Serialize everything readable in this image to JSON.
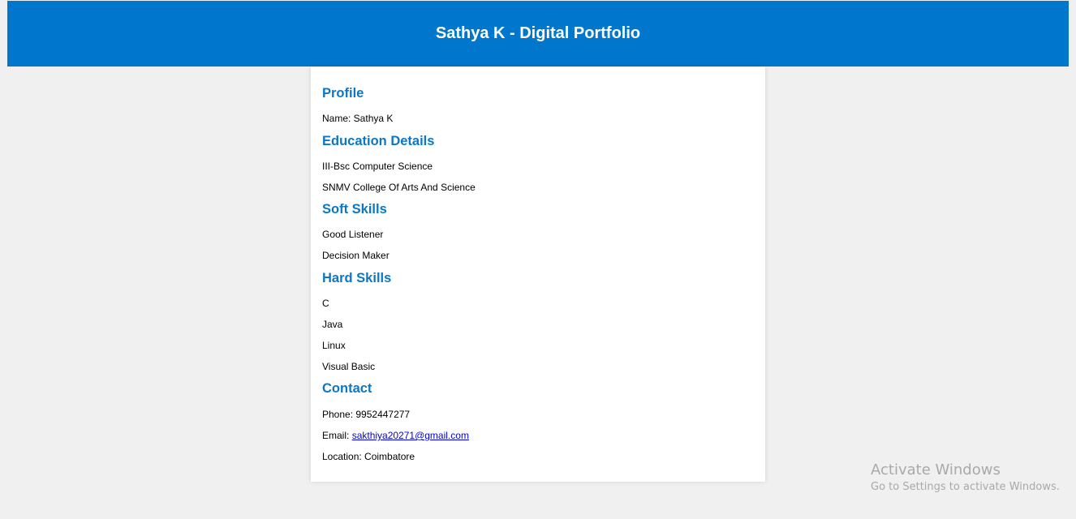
{
  "header": {
    "title": "Sathya K - Digital Portfolio",
    "background": "#0077cc"
  },
  "profile": {
    "heading": "Profile",
    "name_line": "Name: Sathya K"
  },
  "education": {
    "heading": "Education Details",
    "items": [
      "III-Bsc Computer Science",
      "SNMV College Of Arts And Science"
    ]
  },
  "soft_skills": {
    "heading": "Soft Skills",
    "items": [
      "Good Listener",
      "Decision Maker"
    ]
  },
  "hard_skills": {
    "heading": "Hard Skills",
    "items": [
      "C",
      "Java",
      "Linux",
      "Visual Basic"
    ]
  },
  "contact": {
    "heading": "Contact",
    "phone_line": "Phone: 9952447277",
    "email_label": "Email: ",
    "email": "sakthiya20271@gmail.com",
    "location_line": "Location: Coimbatore"
  },
  "watermark": {
    "title": "Activate Windows",
    "subtitle": "Go to Settings to activate Windows."
  },
  "colors": {
    "accent": "#0077cc",
    "heading": "#0a78c7",
    "page_bg": "#f0f0f0"
  }
}
